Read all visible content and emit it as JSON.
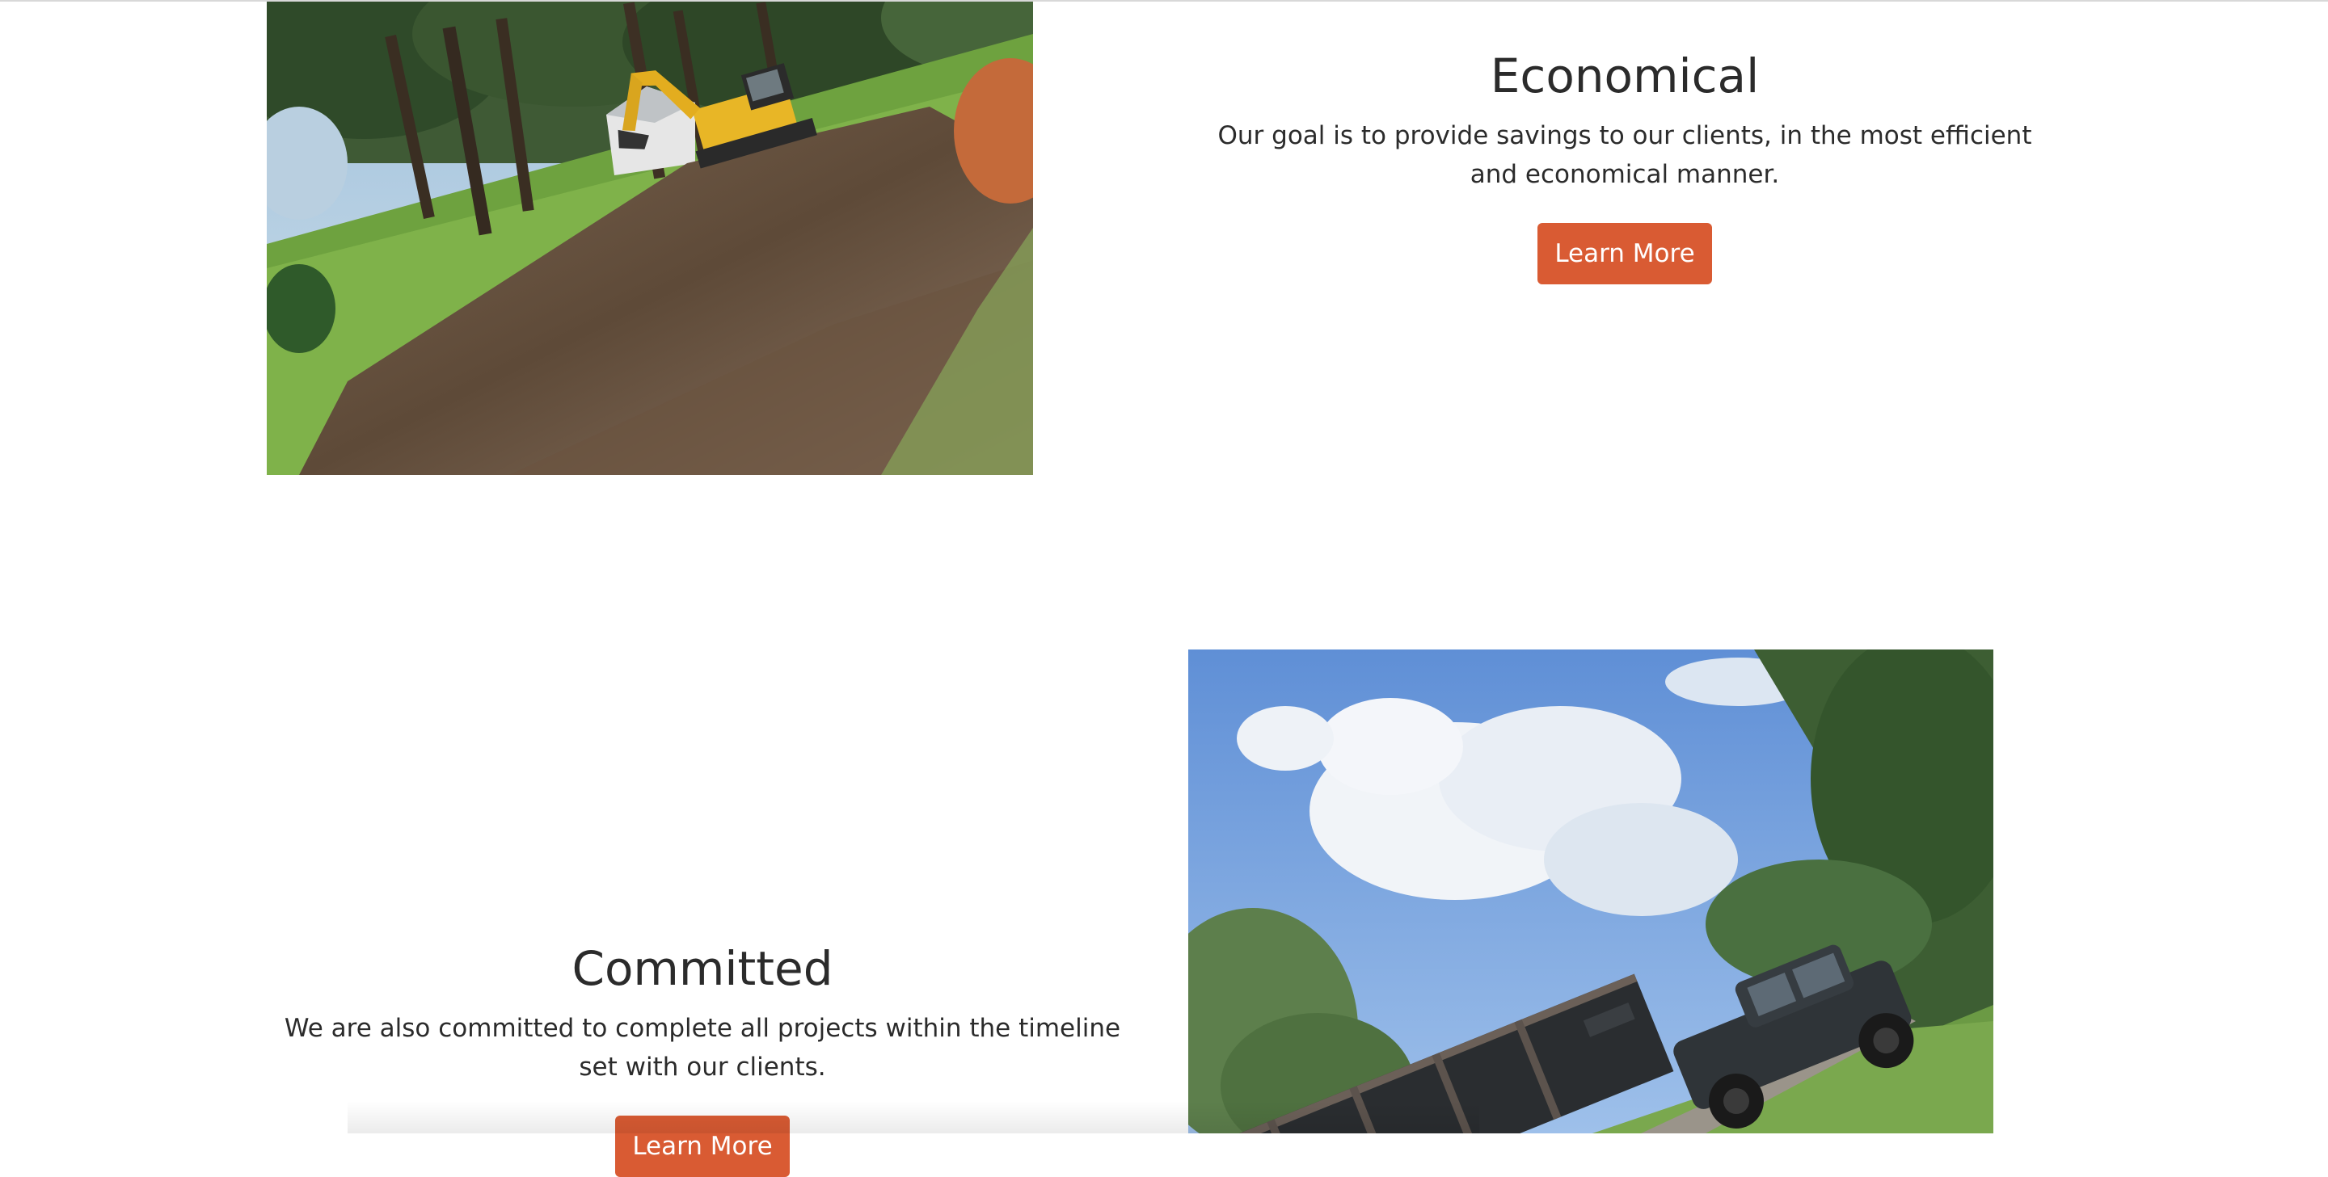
{
  "features": [
    {
      "title": "Economical",
      "description": "Our goal is to provide savings to our clients, in the most efficient and economical manner.",
      "button_label": "Learn More",
      "image_subject": "excavator clearing land"
    },
    {
      "title": "Committed",
      "description": "We are also committed to complete all projects within the timeline set with our clients.",
      "button_label": "Learn More",
      "image_subject": "pickup truck towing dump trailer"
    }
  ],
  "colors": {
    "accent": "#d95b33",
    "text": "#2b2b2b",
    "background": "#ffffff"
  }
}
